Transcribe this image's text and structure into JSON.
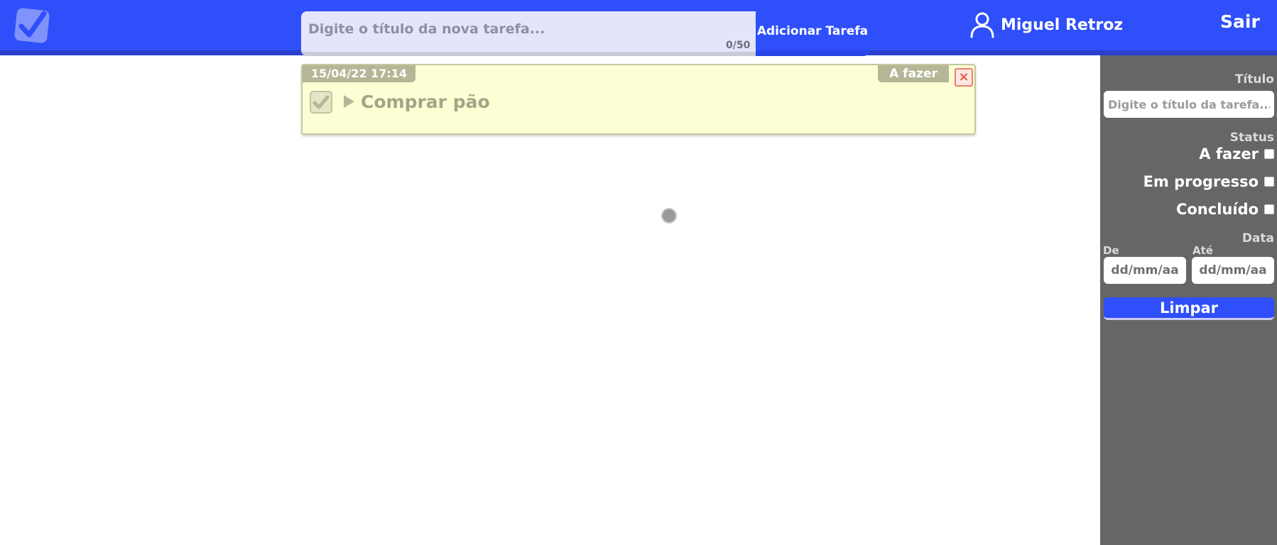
{
  "header": {
    "new_task_placeholder": "Digite o título da nova tarefa...",
    "char_counter": "0/50",
    "add_button": "Adicionar Tarefa",
    "user_name": "Miguel Retroz",
    "logout": "Sair"
  },
  "tasks": [
    {
      "date": "15/04/22 17:14",
      "status": "A fazer",
      "title": "Comprar pão",
      "close_symbol": "×",
      "checked": true
    }
  ],
  "sidebar": {
    "title_label": "Título",
    "title_placeholder": "Digite o título da tarefa...",
    "status_label": "Status",
    "status_options": [
      "A fazer",
      "Em progresso",
      "Concluído"
    ],
    "date_label": "Data",
    "from_label": "De",
    "to_label": "Até",
    "date_placeholder": "dd/mm/aa",
    "clear_button": "Limpar"
  },
  "icons": {
    "logo": "checkmark-logo-icon",
    "user": "user-icon",
    "task_check": "check-icon",
    "expand": "triangle-right-icon",
    "close": "close-icon",
    "loading": "spinner-icon"
  },
  "colors": {
    "primary": "#2f4ffa",
    "card_bg": "#fdfed4",
    "card_accent": "#b4b696",
    "sidebar_bg": "#666666",
    "close_red": "#e4584a"
  }
}
